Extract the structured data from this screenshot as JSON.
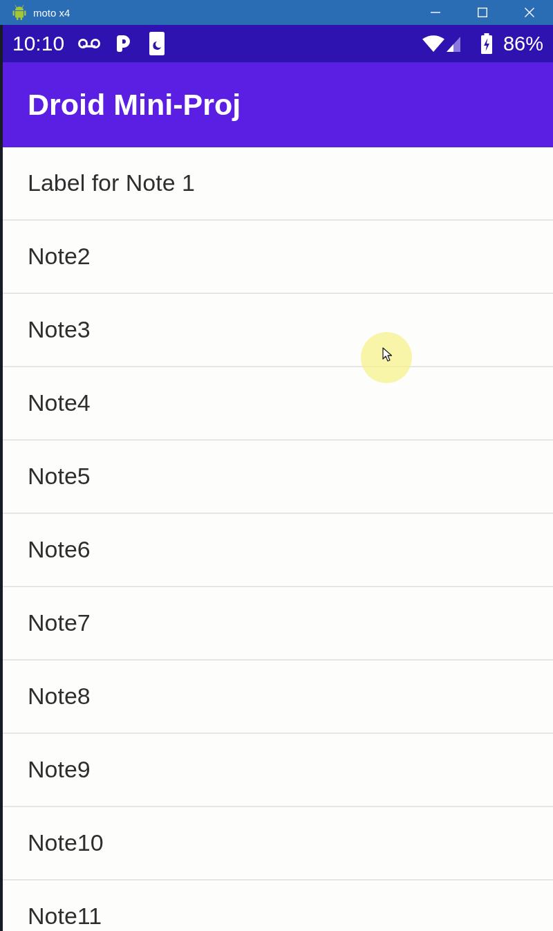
{
  "window": {
    "title": "moto x4"
  },
  "status_bar": {
    "time": "10:10",
    "battery": "86%"
  },
  "app_bar": {
    "title": "Droid Mini-Proj"
  },
  "notes": [
    {
      "label": "Label for Note 1"
    },
    {
      "label": "Note2"
    },
    {
      "label": "Note3"
    },
    {
      "label": "Note4"
    },
    {
      "label": "Note5"
    },
    {
      "label": "Note6"
    },
    {
      "label": "Note7"
    },
    {
      "label": "Note8"
    },
    {
      "label": "Note9"
    },
    {
      "label": "Note10"
    },
    {
      "label": "Note11"
    }
  ]
}
